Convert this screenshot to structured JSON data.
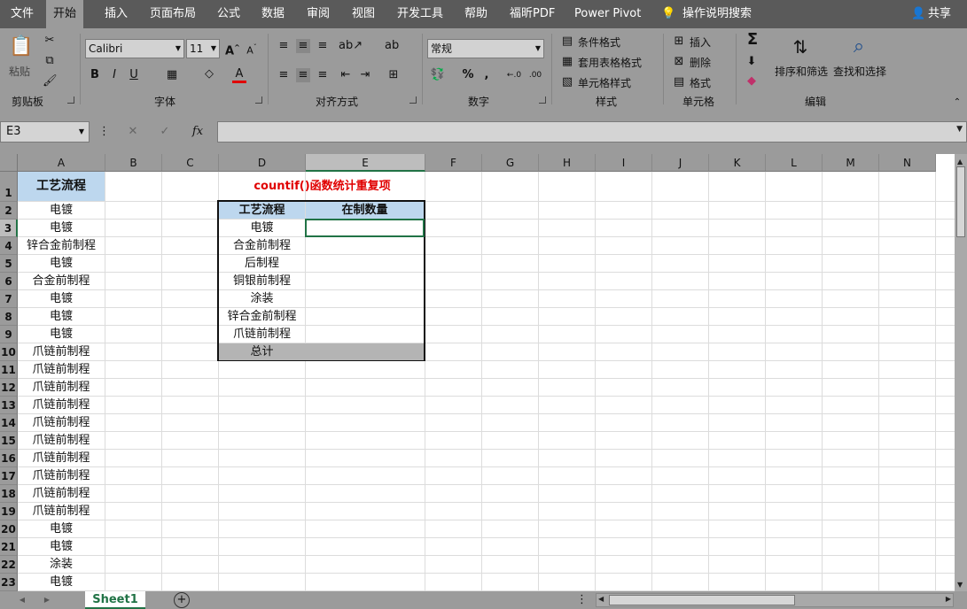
{
  "tabs": [
    "文件",
    "开始",
    "插入",
    "页面布局",
    "公式",
    "数据",
    "审阅",
    "视图",
    "开发工具",
    "帮助",
    "福昕PDF",
    "Power Pivot",
    "操作说明搜索"
  ],
  "share": "共享",
  "ribbon": {
    "groups": [
      "剪贴板",
      "字体",
      "对齐方式",
      "数字",
      "样式",
      "单元格",
      "编辑"
    ],
    "paste": "粘贴",
    "font_name": "Calibri",
    "font_size": "11",
    "number_format": "常规",
    "styles": [
      "条件格式",
      "套用表格格式",
      "单元格样式"
    ],
    "cells": [
      "插入",
      "删除",
      "格式"
    ],
    "edit": [
      "排序和筛选",
      "查找和选择"
    ]
  },
  "namebox": "E3",
  "columns": [
    "A",
    "B",
    "C",
    "D",
    "E",
    "F",
    "G",
    "H",
    "I",
    "J",
    "K",
    "L",
    "M",
    "N"
  ],
  "rows": [
    "1",
    "2",
    "3",
    "4",
    "5",
    "6",
    "7",
    "8",
    "9",
    "10",
    "11",
    "12",
    "13",
    "14",
    "15",
    "16",
    "17",
    "18",
    "19",
    "20",
    "21",
    "22",
    "23"
  ],
  "colA": [
    "工艺流程",
    "电镀",
    "电镀",
    "锌合金前制程",
    "电镀",
    "合金前制程",
    "电镀",
    "电镀",
    "电镀",
    "爪链前制程",
    "爪链前制程",
    "爪链前制程",
    "爪链前制程",
    "爪链前制程",
    "爪链前制程",
    "爪链前制程",
    "爪链前制程",
    "爪链前制程",
    "爪链前制程",
    "电镀",
    "电镀",
    "涂装",
    "电镀"
  ],
  "table": {
    "title": "countif()函数统计重复项",
    "headers": [
      "工艺流程",
      "在制数量"
    ],
    "items": [
      "电镀",
      "合金前制程",
      "后制程",
      "铜银前制程",
      "涂装",
      "锌合金前制程",
      "爪链前制程"
    ],
    "total": "总计"
  },
  "sheet": "Sheet1",
  "colors": {
    "accent": "#217346",
    "header_fill": "#bdd7ee",
    "title_red": "#e00000",
    "total_fill": "#b4b4b4"
  }
}
